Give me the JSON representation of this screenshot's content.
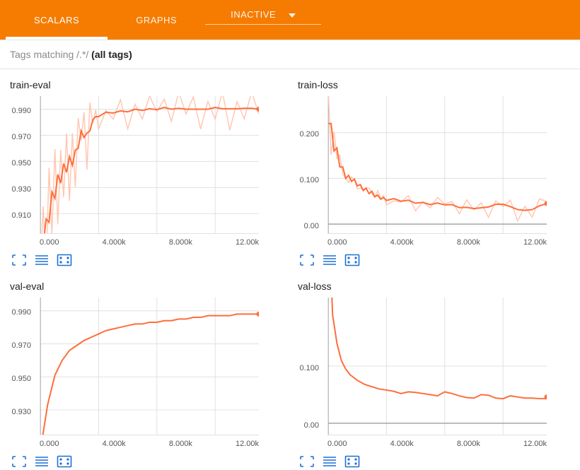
{
  "nav": {
    "tabs": [
      {
        "label": "SCALARS",
        "active": true
      },
      {
        "label": "GRAPHS",
        "active": false
      },
      {
        "label": "INACTIVE",
        "active": false,
        "dropdown": true
      }
    ]
  },
  "filter": {
    "prefix": "Tags matching /.*/ ",
    "bold": "(all tags)"
  },
  "colors": {
    "line": "#ff6d3a",
    "line_light": "#ffc8b3",
    "grid": "#e0e0e0",
    "axis": "#9e9e9e"
  },
  "chart_data": [
    {
      "name": "train-eval",
      "type": "line",
      "xlabel": "",
      "ylabel": "",
      "xticks": [
        "0.000",
        "4.000k",
        "8.000k",
        "12.00k"
      ],
      "yticks": [
        "0.990",
        "0.970",
        "0.950",
        "0.930",
        "0.910"
      ],
      "xlim": [
        0,
        15000
      ],
      "ylim": [
        0.895,
        1.0
      ],
      "x": [
        0,
        200,
        400,
        600,
        800,
        1000,
        1200,
        1400,
        1600,
        1800,
        2000,
        2200,
        2400,
        2600,
        2800,
        3000,
        3200,
        3400,
        3600,
        3800,
        4000,
        4500,
        5000,
        5500,
        6000,
        6500,
        7000,
        7500,
        8000,
        8500,
        9000,
        9500,
        10000,
        10500,
        11000,
        11500,
        12000,
        12500,
        13000,
        13500,
        14000,
        14500,
        15000
      ],
      "values": [
        0.87,
        0.908,
        0.88,
        0.93,
        0.9,
        0.95,
        0.915,
        0.955,
        0.93,
        0.96,
        0.935,
        0.966,
        0.94,
        0.97,
        0.97,
        0.98,
        0.955,
        0.98,
        0.985,
        0.98,
        0.988,
        0.985,
        0.99,
        0.986,
        0.99,
        0.988,
        0.992,
        0.987,
        0.992,
        0.99,
        0.992,
        0.988,
        0.992,
        0.99,
        0.988,
        0.992,
        0.99,
        0.992,
        0.989,
        0.99,
        0.992,
        0.99,
        0.99
      ],
      "end_marker": 0.99
    },
    {
      "name": "train-loss",
      "type": "line",
      "xticks": [
        "0.000",
        "4.000k",
        "8.000k",
        "12.00k"
      ],
      "yticks": [
        "0.200",
        "0.100",
        "0.00"
      ],
      "xlim": [
        0,
        15000
      ],
      "ylim": [
        -0.02,
        0.28
      ],
      "x": [
        0,
        200,
        400,
        600,
        800,
        1000,
        1200,
        1400,
        1600,
        1800,
        2000,
        2200,
        2400,
        2600,
        2800,
        3000,
        3200,
        3400,
        3600,
        3800,
        4000,
        4500,
        5000,
        5500,
        6000,
        6500,
        7000,
        7500,
        8000,
        8500,
        9000,
        9500,
        10000,
        10500,
        11000,
        11500,
        12000,
        12500,
        13000,
        13500,
        14000,
        14500,
        15000
      ],
      "values": [
        0.3,
        0.14,
        0.22,
        0.12,
        0.16,
        0.095,
        0.12,
        0.085,
        0.115,
        0.08,
        0.1,
        0.07,
        0.09,
        0.06,
        0.085,
        0.055,
        0.075,
        0.05,
        0.065,
        0.048,
        0.062,
        0.045,
        0.06,
        0.045,
        0.052,
        0.04,
        0.05,
        0.038,
        0.05,
        0.038,
        0.04,
        0.03,
        0.04,
        0.032,
        0.035,
        0.045,
        0.05,
        0.035,
        0.03,
        0.03,
        0.03,
        0.035,
        0.055
      ],
      "end_marker": 0.045
    },
    {
      "name": "val-eval",
      "type": "line",
      "xticks": [
        "0.000",
        "4.000k",
        "8.000k",
        "12.00k"
      ],
      "yticks": [
        "0.990",
        "0.970",
        "0.950",
        "0.930"
      ],
      "xlim": [
        0,
        15000
      ],
      "ylim": [
        0.915,
        0.998
      ],
      "x": [
        0,
        500,
        1000,
        1500,
        2000,
        2500,
        3000,
        3500,
        4000,
        4500,
        5000,
        5500,
        6000,
        6500,
        7000,
        7500,
        8000,
        8500,
        9000,
        9500,
        10000,
        10500,
        11000,
        11500,
        12000,
        12500,
        13000,
        13500,
        14000,
        14500,
        15000
      ],
      "values": [
        0.905,
        0.933,
        0.951,
        0.96,
        0.966,
        0.969,
        0.972,
        0.974,
        0.976,
        0.978,
        0.979,
        0.98,
        0.981,
        0.982,
        0.982,
        0.983,
        0.983,
        0.984,
        0.984,
        0.985,
        0.985,
        0.986,
        0.986,
        0.987,
        0.987,
        0.987,
        0.987,
        0.988,
        0.988,
        0.988,
        0.988
      ],
      "end_marker": 0.988
    },
    {
      "name": "val-loss",
      "type": "line",
      "xticks": [
        "0.000",
        "4.000k",
        "8.000k",
        "12.00k"
      ],
      "yticks": [
        "0.100",
        "0.00"
      ],
      "xlim": [
        0,
        15000
      ],
      "ylim": [
        -0.02,
        0.22
      ],
      "x": [
        0,
        300,
        600,
        900,
        1200,
        1500,
        2000,
        2500,
        3000,
        3500,
        4000,
        4500,
        5000,
        5500,
        6000,
        6500,
        7000,
        7500,
        8000,
        8500,
        9000,
        9500,
        10000,
        10500,
        11000,
        11500,
        12000,
        12500,
        13000,
        13500,
        14000,
        14500,
        15000
      ],
      "values": [
        0.4,
        0.19,
        0.14,
        0.11,
        0.095,
        0.085,
        0.075,
        0.068,
        0.064,
        0.06,
        0.058,
        0.056,
        0.052,
        0.055,
        0.054,
        0.052,
        0.05,
        0.048,
        0.055,
        0.052,
        0.048,
        0.045,
        0.044,
        0.05,
        0.049,
        0.044,
        0.043,
        0.048,
        0.046,
        0.044,
        0.044,
        0.043,
        0.043
      ],
      "end_marker": 0.046
    }
  ],
  "tool_labels": [
    "expand",
    "log-scale",
    "fit-domain"
  ]
}
